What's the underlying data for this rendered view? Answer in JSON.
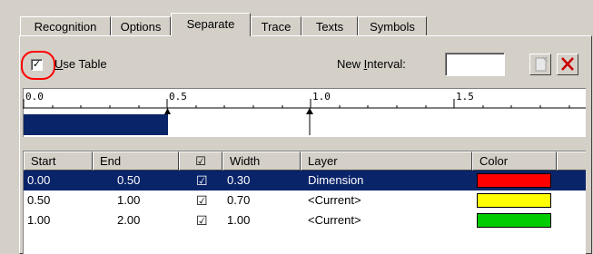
{
  "tabs": [
    {
      "label": "Recognition"
    },
    {
      "label": "Options"
    },
    {
      "label": "Separate"
    },
    {
      "label": "Trace"
    },
    {
      "label": "Texts"
    },
    {
      "label": "Symbols"
    }
  ],
  "active_tab": "Separate",
  "use_table": {
    "label": "Use Table",
    "checked": true,
    "check_glyph": "✓"
  },
  "new_interval": {
    "label": "New Interval:",
    "value": ""
  },
  "ruler": {
    "ticks": [
      "0.0",
      "0.5",
      "1.0",
      "1.5"
    ],
    "selected_range": [
      0.0,
      0.5
    ],
    "markers": [
      0.5,
      1.0
    ]
  },
  "table": {
    "headers": [
      "Start",
      "End",
      "☑",
      "Width",
      "Layer",
      "Color"
    ],
    "rows": [
      {
        "start": "0.00",
        "end": "0.50",
        "checked": "☑",
        "width": "0.30",
        "layer": "Dimension",
        "color": "#ff0000",
        "selected": true
      },
      {
        "start": "0.50",
        "end": "1.00",
        "checked": "☑",
        "width": "0.70",
        "layer": "<Current>",
        "color": "#ffff00",
        "selected": false
      },
      {
        "start": "1.00",
        "end": "2.00",
        "checked": "☑",
        "width": "1.00",
        "layer": "<Current>",
        "color": "#00cc00",
        "selected": false
      }
    ]
  },
  "colors": {
    "selection": "#0a246a",
    "face": "#d4d0c8",
    "delete_x": "#cc0000",
    "highlight_circle": "#ff0000"
  }
}
